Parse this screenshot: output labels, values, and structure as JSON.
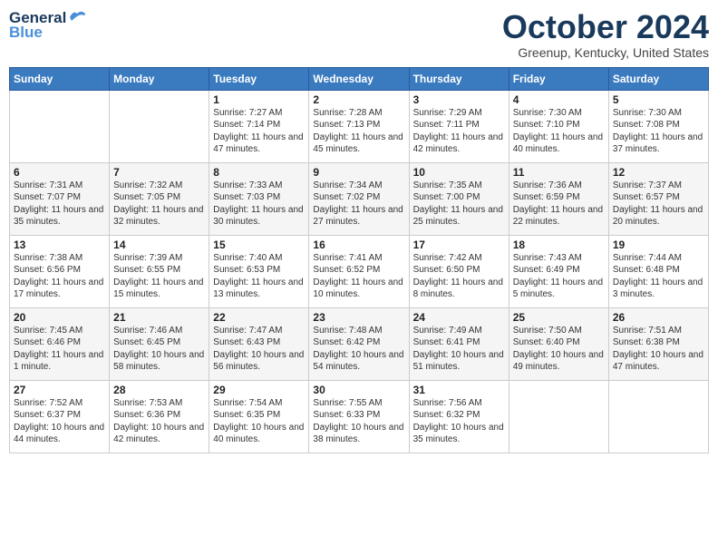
{
  "header": {
    "logo_general": "General",
    "logo_blue": "Blue",
    "month": "October 2024",
    "location": "Greenup, Kentucky, United States"
  },
  "days_of_week": [
    "Sunday",
    "Monday",
    "Tuesday",
    "Wednesday",
    "Thursday",
    "Friday",
    "Saturday"
  ],
  "weeks": [
    [
      {
        "day": "",
        "content": ""
      },
      {
        "day": "",
        "content": ""
      },
      {
        "day": "1",
        "content": "Sunrise: 7:27 AM\nSunset: 7:14 PM\nDaylight: 11 hours and 47 minutes."
      },
      {
        "day": "2",
        "content": "Sunrise: 7:28 AM\nSunset: 7:13 PM\nDaylight: 11 hours and 45 minutes."
      },
      {
        "day": "3",
        "content": "Sunrise: 7:29 AM\nSunset: 7:11 PM\nDaylight: 11 hours and 42 minutes."
      },
      {
        "day": "4",
        "content": "Sunrise: 7:30 AM\nSunset: 7:10 PM\nDaylight: 11 hours and 40 minutes."
      },
      {
        "day": "5",
        "content": "Sunrise: 7:30 AM\nSunset: 7:08 PM\nDaylight: 11 hours and 37 minutes."
      }
    ],
    [
      {
        "day": "6",
        "content": "Sunrise: 7:31 AM\nSunset: 7:07 PM\nDaylight: 11 hours and 35 minutes."
      },
      {
        "day": "7",
        "content": "Sunrise: 7:32 AM\nSunset: 7:05 PM\nDaylight: 11 hours and 32 minutes."
      },
      {
        "day": "8",
        "content": "Sunrise: 7:33 AM\nSunset: 7:03 PM\nDaylight: 11 hours and 30 minutes."
      },
      {
        "day": "9",
        "content": "Sunrise: 7:34 AM\nSunset: 7:02 PM\nDaylight: 11 hours and 27 minutes."
      },
      {
        "day": "10",
        "content": "Sunrise: 7:35 AM\nSunset: 7:00 PM\nDaylight: 11 hours and 25 minutes."
      },
      {
        "day": "11",
        "content": "Sunrise: 7:36 AM\nSunset: 6:59 PM\nDaylight: 11 hours and 22 minutes."
      },
      {
        "day": "12",
        "content": "Sunrise: 7:37 AM\nSunset: 6:57 PM\nDaylight: 11 hours and 20 minutes."
      }
    ],
    [
      {
        "day": "13",
        "content": "Sunrise: 7:38 AM\nSunset: 6:56 PM\nDaylight: 11 hours and 17 minutes."
      },
      {
        "day": "14",
        "content": "Sunrise: 7:39 AM\nSunset: 6:55 PM\nDaylight: 11 hours and 15 minutes."
      },
      {
        "day": "15",
        "content": "Sunrise: 7:40 AM\nSunset: 6:53 PM\nDaylight: 11 hours and 13 minutes."
      },
      {
        "day": "16",
        "content": "Sunrise: 7:41 AM\nSunset: 6:52 PM\nDaylight: 11 hours and 10 minutes."
      },
      {
        "day": "17",
        "content": "Sunrise: 7:42 AM\nSunset: 6:50 PM\nDaylight: 11 hours and 8 minutes."
      },
      {
        "day": "18",
        "content": "Sunrise: 7:43 AM\nSunset: 6:49 PM\nDaylight: 11 hours and 5 minutes."
      },
      {
        "day": "19",
        "content": "Sunrise: 7:44 AM\nSunset: 6:48 PM\nDaylight: 11 hours and 3 minutes."
      }
    ],
    [
      {
        "day": "20",
        "content": "Sunrise: 7:45 AM\nSunset: 6:46 PM\nDaylight: 11 hours and 1 minute."
      },
      {
        "day": "21",
        "content": "Sunrise: 7:46 AM\nSunset: 6:45 PM\nDaylight: 10 hours and 58 minutes."
      },
      {
        "day": "22",
        "content": "Sunrise: 7:47 AM\nSunset: 6:43 PM\nDaylight: 10 hours and 56 minutes."
      },
      {
        "day": "23",
        "content": "Sunrise: 7:48 AM\nSunset: 6:42 PM\nDaylight: 10 hours and 54 minutes."
      },
      {
        "day": "24",
        "content": "Sunrise: 7:49 AM\nSunset: 6:41 PM\nDaylight: 10 hours and 51 minutes."
      },
      {
        "day": "25",
        "content": "Sunrise: 7:50 AM\nSunset: 6:40 PM\nDaylight: 10 hours and 49 minutes."
      },
      {
        "day": "26",
        "content": "Sunrise: 7:51 AM\nSunset: 6:38 PM\nDaylight: 10 hours and 47 minutes."
      }
    ],
    [
      {
        "day": "27",
        "content": "Sunrise: 7:52 AM\nSunset: 6:37 PM\nDaylight: 10 hours and 44 minutes."
      },
      {
        "day": "28",
        "content": "Sunrise: 7:53 AM\nSunset: 6:36 PM\nDaylight: 10 hours and 42 minutes."
      },
      {
        "day": "29",
        "content": "Sunrise: 7:54 AM\nSunset: 6:35 PM\nDaylight: 10 hours and 40 minutes."
      },
      {
        "day": "30",
        "content": "Sunrise: 7:55 AM\nSunset: 6:33 PM\nDaylight: 10 hours and 38 minutes."
      },
      {
        "day": "31",
        "content": "Sunrise: 7:56 AM\nSunset: 6:32 PM\nDaylight: 10 hours and 35 minutes."
      },
      {
        "day": "",
        "content": ""
      },
      {
        "day": "",
        "content": ""
      }
    ]
  ]
}
